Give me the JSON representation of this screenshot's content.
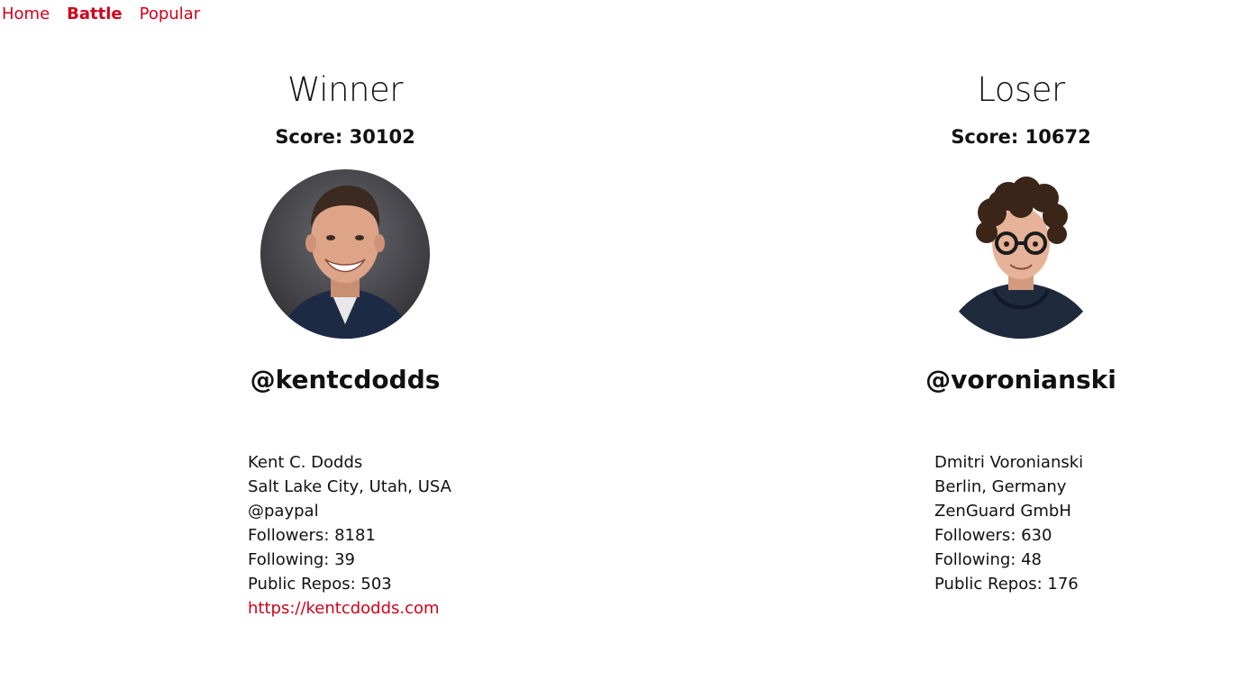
{
  "nav": {
    "items": [
      {
        "label": "Home",
        "active": false
      },
      {
        "label": "Battle",
        "active": true
      },
      {
        "label": "Popular",
        "active": false
      }
    ],
    "accent_color": "#d0021b"
  },
  "players": [
    {
      "header": "Winner",
      "score": "Score: 30102",
      "handle": "@kentcdodds",
      "name": "Kent C. Dodds",
      "location": "Salt Lake City, Utah, USA",
      "company": "@paypal",
      "followers": "Followers: 8181",
      "following": "Following: 39",
      "public_repos": "Public Repos: 503",
      "blog": "https://kentcdodds.com",
      "avatar_icon": "profile-photo"
    },
    {
      "header": "Loser",
      "score": "Score: 10672",
      "handle": "@voronianski",
      "name": "Dmitri Voronianski",
      "location": "Berlin, Germany",
      "company": "ZenGuard GmbH",
      "followers": "Followers: 630",
      "following": "Following: 48",
      "public_repos": "Public Repos: 176",
      "avatar_icon": "cartoon-avatar"
    }
  ]
}
